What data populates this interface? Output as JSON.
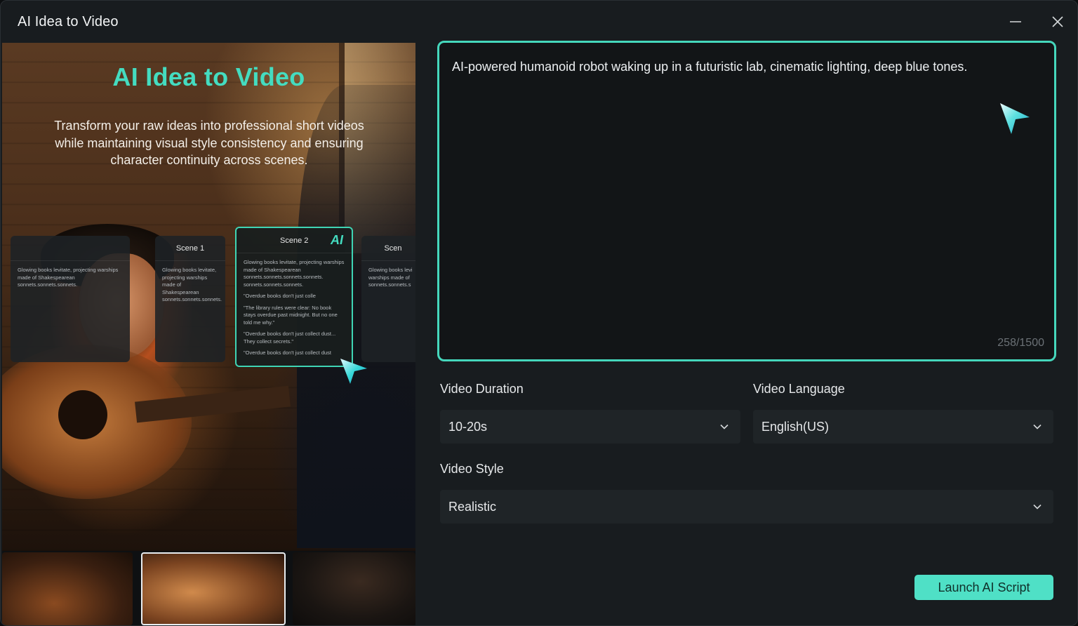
{
  "window": {
    "title": "AI Idea to Video"
  },
  "preview": {
    "hero_title": "AI Idea to Video",
    "hero_subtitle": "Transform your raw ideas into professional short videos while maintaining visual style consistency and ensuring character continuity across scenes.",
    "scene_cards": [
      {
        "title": "Scene 1",
        "body": "Glowing books levitate, projecting warships made of Shakespearean sonnets.sonnets.sonnets."
      },
      {
        "title": "Scene 2",
        "badge": "AI",
        "body": [
          "Glowing books levitate, projecting warships made of Shakespearean sonnets.sonnets.sonnets.sonnets. sonnets.sonnets.sonnets.",
          "\"Overdue books don't just colle",
          "\"The library rules were clear: No book stays overdue past midnight. But no one told me why.\"",
          "\"Overdue books don't just collect dust... They collect secrets.\"",
          "\"Overdue books don't just collect dust"
        ]
      },
      {
        "title": "Scen",
        "body": "Glowing books levi warships made of sonnets.sonnets.s"
      }
    ],
    "thumbnails": [
      "thumb-1",
      "thumb-2",
      "thumb-3"
    ]
  },
  "prompt": {
    "text": "AI-powered humanoid robot waking up in a futuristic lab, cinematic lighting, deep blue tones.",
    "counter": "258/1500"
  },
  "fields": {
    "duration": {
      "label": "Video Duration",
      "value": "10-20s"
    },
    "language": {
      "label": "Video Language",
      "value": "English(US)"
    },
    "style": {
      "label": "Video Style",
      "value": "Realistic"
    }
  },
  "actions": {
    "launch_label": "Launch AI Script"
  },
  "colors": {
    "accent": "#45d7bc",
    "button": "#4fe0c6",
    "panel": "#181c1f",
    "field": "#1f2427"
  },
  "icons": [
    "minimize-icon",
    "close-icon",
    "chevron-down-icon",
    "send-cursor-icon"
  ]
}
